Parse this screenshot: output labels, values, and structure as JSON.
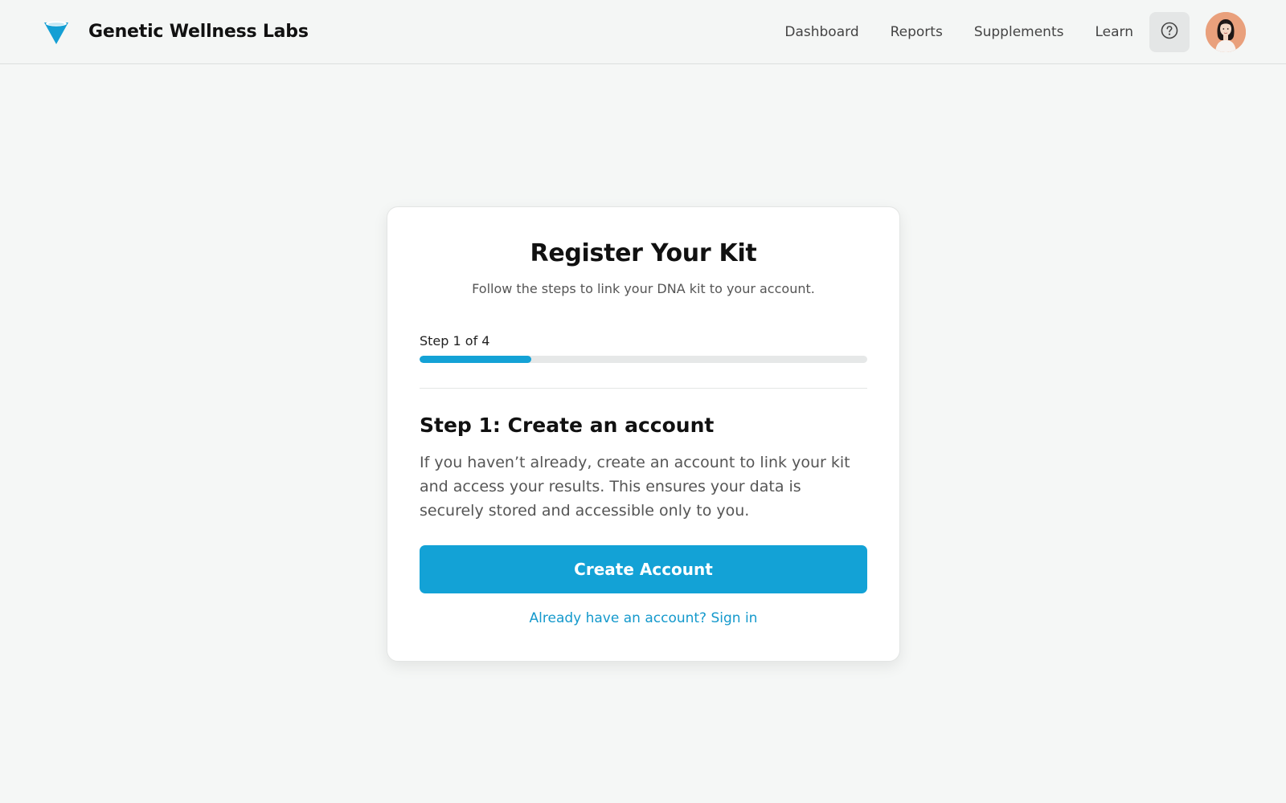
{
  "brand": {
    "name": "Genetic Wellness Labs",
    "logo_icon": "funnel-drop-icon"
  },
  "nav": {
    "links": [
      {
        "label": "Dashboard"
      },
      {
        "label": "Reports"
      },
      {
        "label": "Supplements"
      },
      {
        "label": "Learn"
      }
    ],
    "help_icon": "question-circle-icon",
    "avatar": "user-avatar"
  },
  "card": {
    "title": "Register Your Kit",
    "subtitle": "Follow the steps to link your DNA kit to your account.",
    "step_label": "Step 1 of 4",
    "progress": {
      "current": 1,
      "total": 4,
      "fraction": 0.25
    },
    "section_heading": "Step 1: Create an account",
    "section_body": "If you haven’t already, create an account to link your kit and access your results. This ensures your data is securely stored and accessible only to you.",
    "primary_button": "Create Account",
    "signin_link": "Already have an account? Sign in"
  },
  "colors": {
    "accent": "#13a2d6",
    "link": "#1499cc",
    "background": "#f5f7f6",
    "card": "#ffffff"
  }
}
